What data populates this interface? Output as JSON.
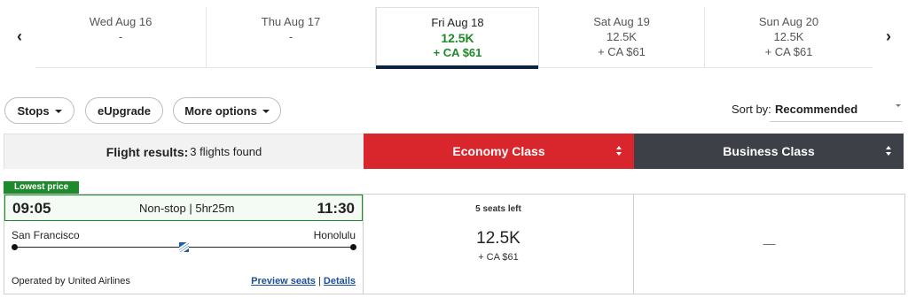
{
  "date_strip": {
    "prev_arrow": "‹",
    "next_arrow": "›",
    "dates": [
      {
        "date": "Wed Aug 16",
        "miles": "-",
        "fee": ""
      },
      {
        "date": "Thu Aug 17",
        "miles": "-",
        "fee": ""
      },
      {
        "date": "Fri Aug 18",
        "miles": "12.5K",
        "fee": "+ CA $61",
        "selected": true
      },
      {
        "date": "Sat Aug 19",
        "miles": "12.5K",
        "fee": "+ CA $61"
      },
      {
        "date": "Sun Aug 20",
        "miles": "12.5K",
        "fee": "+ CA $61"
      }
    ]
  },
  "filters": {
    "stops": "Stops",
    "eupgrade": "eUpgrade",
    "more_options": "More options"
  },
  "sort": {
    "label": "Sort by:",
    "value": "Recommended"
  },
  "results_header": {
    "label": "Flight results:",
    "count": "3 flights found"
  },
  "cabins": {
    "economy": "Economy Class",
    "business": "Business Class"
  },
  "flight": {
    "badge": "Lowest price",
    "depart_time": "09:05",
    "summary": "Non-stop | 5hr25m",
    "arrive_time": "11:30",
    "origin": "San Francisco",
    "destination": "Honolulu",
    "operated_by": "Operated by United Airlines",
    "preview_seats": "Preview seats",
    "separator": "|",
    "details": "Details",
    "airline_icon": "united-airlines-globe-icon",
    "economy": {
      "seats_left": "5 seats left",
      "miles": "12.5K",
      "fee": "+ CA $61"
    },
    "business": {
      "value": "—"
    }
  },
  "colors": {
    "economy_header": "#d9262c",
    "business_header": "#3d4147",
    "price_green": "#1e8a2c",
    "selected_underline": "#0c2340"
  }
}
